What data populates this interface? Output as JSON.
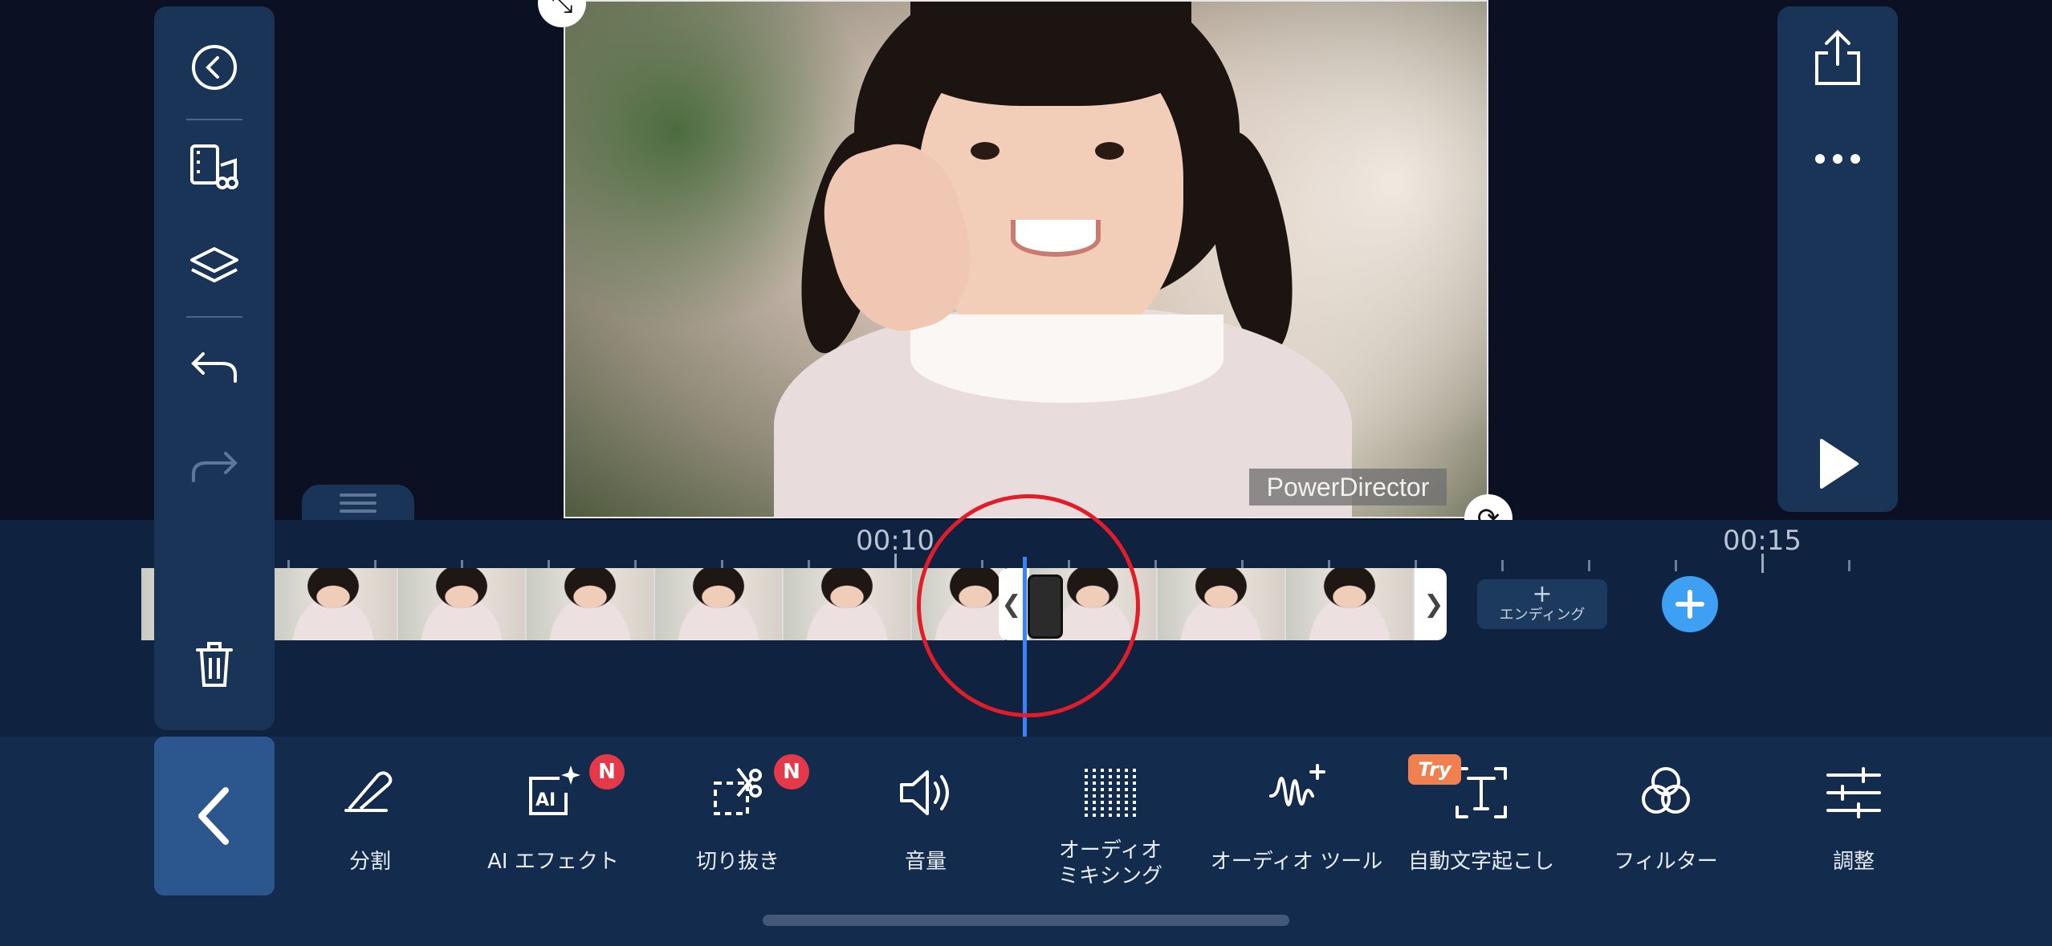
{
  "preview": {
    "watermark": "PowerDirector"
  },
  "timeline": {
    "ruler_labels": [
      "00:10",
      "00:15"
    ],
    "ending_label": "エンディング",
    "ending_plus": "+"
  },
  "toolbar": {
    "tools": [
      {
        "label": "分割"
      },
      {
        "label": "AI エフェクト",
        "badge": "N"
      },
      {
        "label": "切り抜き",
        "badge": "N"
      },
      {
        "label": "音量"
      },
      {
        "label": "オーディオ\nミキシング"
      },
      {
        "label": "オーディオ ツール"
      },
      {
        "label": "自動文字起こし",
        "badge": "Try"
      },
      {
        "label": "フィルター"
      },
      {
        "label": "調整"
      }
    ]
  },
  "colors": {
    "accent": "#3da0f2",
    "highlight_circle": "#e11d2a",
    "badge_red": "#e53949",
    "badge_try": "#f08050"
  }
}
